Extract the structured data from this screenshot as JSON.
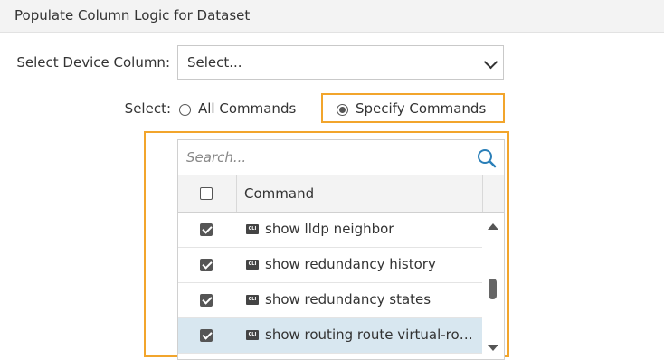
{
  "title": "Populate Column Logic for Dataset",
  "device": {
    "label": "Select Device Column:",
    "value": "Select...",
    "icon": "chevron-down-icon"
  },
  "mode": {
    "label": "Select:",
    "options": [
      {
        "label": "All Commands",
        "selected": false
      },
      {
        "label": "Specify Commands",
        "selected": true
      }
    ]
  },
  "search": {
    "placeholder": "Search...",
    "icon": "search-icon",
    "icon_color": "#2a7fb8"
  },
  "table": {
    "header": "Command",
    "header_checked": false,
    "badge": "CLI",
    "rows": [
      {
        "label": "show lldp neighbor",
        "checked": true,
        "highlighted": false
      },
      {
        "label": "show redundancy history",
        "checked": true,
        "highlighted": false
      },
      {
        "label": "show redundancy states",
        "checked": true,
        "highlighted": false
      },
      {
        "label": "show routing route virtual-rou...",
        "checked": true,
        "highlighted": true
      }
    ]
  },
  "colors": {
    "highlight_border": "#f2a52c",
    "selected_row": "#d8e7f0"
  }
}
